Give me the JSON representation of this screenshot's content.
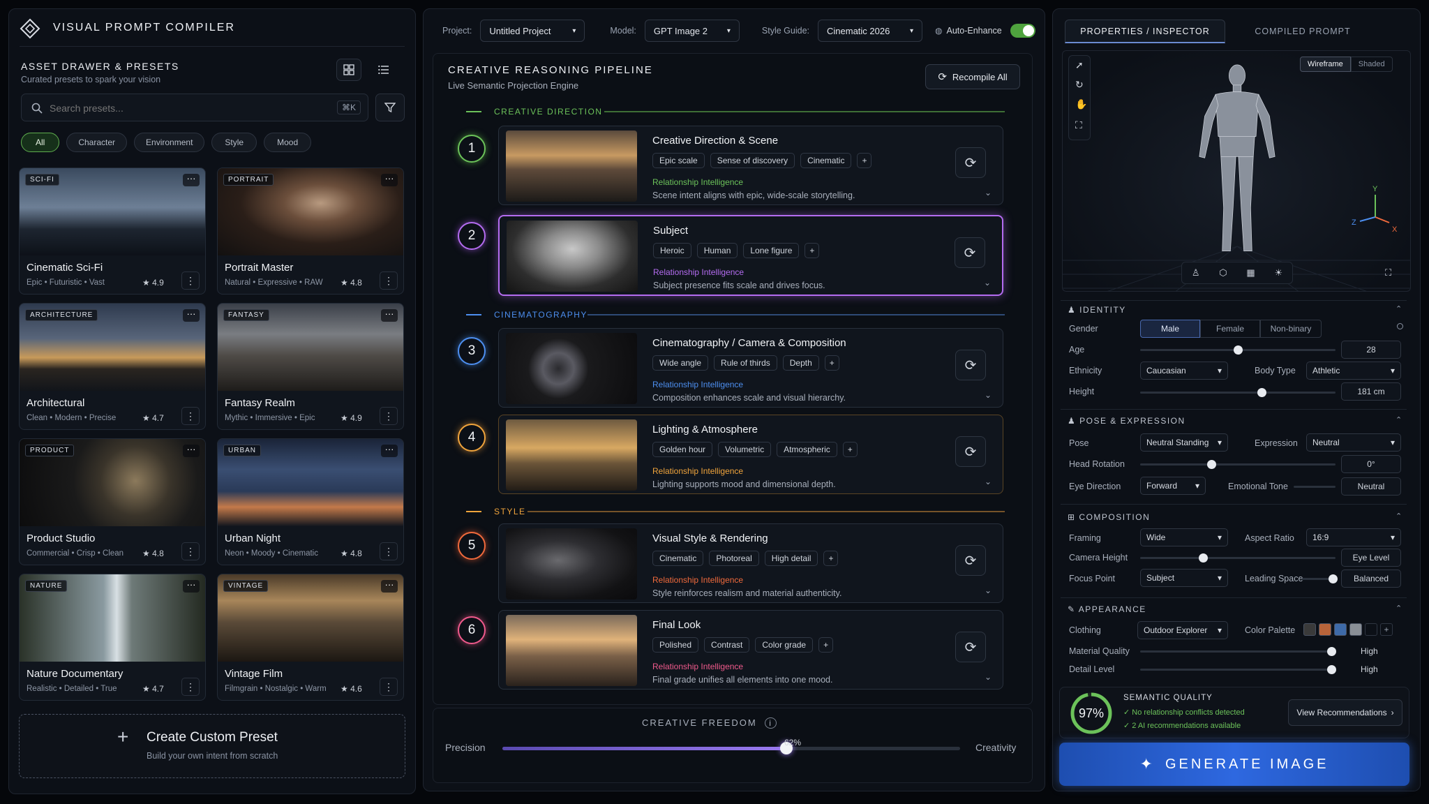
{
  "app": {
    "title": "VISUAL PROMPT COMPILER"
  },
  "drawer": {
    "title": "ASSET DRAWER & PRESETS",
    "subtitle": "Curated presets to spark your vision",
    "search_placeholder": "Search presets...",
    "shortcut": "⌘K",
    "filters": [
      "All",
      "Character",
      "Environment",
      "Style",
      "Mood"
    ],
    "presets": [
      {
        "tag": "SCI-FI",
        "title": "Cinematic Sci-Fi",
        "sub": "Epic • Futuristic • Vast",
        "rating": "4.9"
      },
      {
        "tag": "PORTRAIT",
        "title": "Portrait Master",
        "sub": "Natural • Expressive • RAW",
        "rating": "4.8"
      },
      {
        "tag": "ARCHITECTURE",
        "title": "Architectural",
        "sub": "Clean • Modern • Precise",
        "rating": "4.7"
      },
      {
        "tag": "FANTASY",
        "title": "Fantasy Realm",
        "sub": "Mythic • Immersive • Epic",
        "rating": "4.9"
      },
      {
        "tag": "PRODUCT",
        "title": "Product Studio",
        "sub": "Commercial • Crisp • Clean",
        "rating": "4.8"
      },
      {
        "tag": "URBAN",
        "title": "Urban Night",
        "sub": "Neon • Moody • Cinematic",
        "rating": "4.8"
      },
      {
        "tag": "NATURE",
        "title": "Nature Documentary",
        "sub": "Realistic • Detailed • True",
        "rating": "4.7"
      },
      {
        "tag": "VINTAGE",
        "title": "Vintage Film",
        "sub": "Filmgrain • Nostalgic • Warm",
        "rating": "4.6"
      }
    ],
    "custom": {
      "title": "Create Custom Preset",
      "sub": "Build your own intent from scratch"
    }
  },
  "topbar": {
    "project_label": "Project:",
    "project": "Untitled Project",
    "model_label": "Model:",
    "model": "GPT Image 2",
    "style_label": "Style Guide:",
    "style": "Cinematic 2026",
    "auto_label": "Auto-Enhance"
  },
  "pipeline": {
    "title": "CREATIVE REASONING PIPELINE",
    "subtitle": "Live Semantic Projection Engine",
    "recompile": "Recompile All",
    "sections": {
      "direction": "CREATIVE DIRECTION",
      "cinema": "CINEMATOGRAPHY",
      "style": "STYLE"
    },
    "ri_label": "Relationship Intelligence",
    "stages": [
      {
        "num": "1",
        "title": "Creative Direction & Scene",
        "chips": [
          "Epic scale",
          "Sense of discovery",
          "Cinematic"
        ],
        "desc": "Scene intent aligns with epic, wide-scale storytelling.",
        "color": "#6cc25a"
      },
      {
        "num": "2",
        "title": "Subject",
        "chips": [
          "Heroic",
          "Human",
          "Lone figure"
        ],
        "desc": "Subject presence fits scale and drives focus.",
        "color": "#b46cf0"
      },
      {
        "num": "3",
        "title": "Cinematography / Camera & Composition",
        "chips": [
          "Wide angle",
          "Rule of thirds",
          "Depth"
        ],
        "desc": "Composition enhances scale and visual hierarchy.",
        "color": "#4d8ff0"
      },
      {
        "num": "4",
        "title": "Lighting & Atmosphere",
        "chips": [
          "Golden hour",
          "Volumetric",
          "Atmospheric"
        ],
        "desc": "Lighting supports mood and dimensional depth.",
        "color": "#f0a43c"
      },
      {
        "num": "5",
        "title": "Visual Style & Rendering",
        "chips": [
          "Cinematic",
          "Photoreal",
          "High detail"
        ],
        "desc": "Style reinforces realism and material authenticity.",
        "color": "#f06a3c"
      },
      {
        "num": "6",
        "title": "Final Look",
        "chips": [
          "Polished",
          "Contrast",
          "Color grade"
        ],
        "desc": "Final grade unifies all elements into one mood.",
        "color": "#f05a8c"
      }
    ],
    "freedom": {
      "title": "CREATIVE FREEDOM",
      "left": "Precision",
      "right": "Creativity",
      "value": "62%"
    }
  },
  "inspector": {
    "tabs": [
      "PROPERTIES / INSPECTOR",
      "COMPILED PROMPT"
    ],
    "view_modes": [
      "Wireframe",
      "Shaded"
    ],
    "axes": {
      "x": "X",
      "y": "Y",
      "z": "Z"
    },
    "identity": {
      "title": "IDENTITY",
      "gender_label": "Gender",
      "genders": [
        "Male",
        "Female",
        "Non-binary"
      ],
      "age_label": "Age",
      "age": "28",
      "ethnicity_label": "Ethnicity",
      "ethnicity": "Caucasian",
      "body_label": "Body Type",
      "body": "Athletic",
      "height_label": "Height",
      "height": "181 cm"
    },
    "pose": {
      "title": "POSE & EXPRESSION",
      "pose_label": "Pose",
      "pose": "Neutral Standing",
      "expr_label": "Expression",
      "expr": "Neutral",
      "head_label": "Head Rotation",
      "head": "0°",
      "eye_label": "Eye Direction",
      "eye": "Forward",
      "tone_label": "Emotional Tone",
      "tone": "Neutral"
    },
    "composition": {
      "title": "COMPOSITION",
      "framing_label": "Framing",
      "framing": "Wide",
      "aspect_label": "Aspect Ratio",
      "aspect": "16:9",
      "camh_label": "Camera Height",
      "camh": "Eye Level",
      "focus_label": "Focus Point",
      "focus": "Subject",
      "lead_label": "Leading Space",
      "lead": "Balanced"
    },
    "appearance": {
      "title": "APPEARANCE",
      "clothing_label": "Clothing",
      "clothing": "Outdoor Explorer",
      "palette_label": "Color Palette",
      "palette": [
        "#3a3a3a",
        "#b8643a",
        "#3e6aa8",
        "#8a8f96"
      ],
      "material_label": "Material Quality",
      "material": "High",
      "detail_label": "Detail Level",
      "detail": "High"
    },
    "quality": {
      "score": "97%",
      "title": "SEMANTIC QUALITY",
      "line1": "No relationship conflicts detected",
      "line2": "2 AI recommendations available",
      "button": "View Recommendations"
    },
    "generate": "GENERATE IMAGE"
  }
}
